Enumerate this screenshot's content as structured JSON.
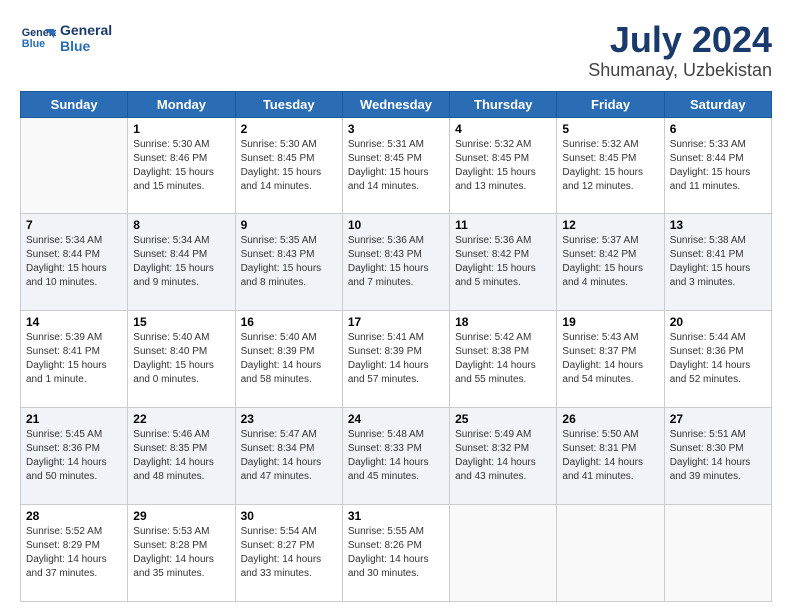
{
  "header": {
    "logo_line1": "General",
    "logo_line2": "Blue",
    "title": "July 2024",
    "subtitle": "Shumanay, Uzbekistan"
  },
  "days_of_week": [
    "Sunday",
    "Monday",
    "Tuesday",
    "Wednesday",
    "Thursday",
    "Friday",
    "Saturday"
  ],
  "weeks": [
    [
      {
        "day": "",
        "info": ""
      },
      {
        "day": "1",
        "info": "Sunrise: 5:30 AM\nSunset: 8:46 PM\nDaylight: 15 hours\nand 15 minutes."
      },
      {
        "day": "2",
        "info": "Sunrise: 5:30 AM\nSunset: 8:45 PM\nDaylight: 15 hours\nand 14 minutes."
      },
      {
        "day": "3",
        "info": "Sunrise: 5:31 AM\nSunset: 8:45 PM\nDaylight: 15 hours\nand 14 minutes."
      },
      {
        "day": "4",
        "info": "Sunrise: 5:32 AM\nSunset: 8:45 PM\nDaylight: 15 hours\nand 13 minutes."
      },
      {
        "day": "5",
        "info": "Sunrise: 5:32 AM\nSunset: 8:45 PM\nDaylight: 15 hours\nand 12 minutes."
      },
      {
        "day": "6",
        "info": "Sunrise: 5:33 AM\nSunset: 8:44 PM\nDaylight: 15 hours\nand 11 minutes."
      }
    ],
    [
      {
        "day": "7",
        "info": "Sunrise: 5:34 AM\nSunset: 8:44 PM\nDaylight: 15 hours\nand 10 minutes."
      },
      {
        "day": "8",
        "info": "Sunrise: 5:34 AM\nSunset: 8:44 PM\nDaylight: 15 hours\nand 9 minutes."
      },
      {
        "day": "9",
        "info": "Sunrise: 5:35 AM\nSunset: 8:43 PM\nDaylight: 15 hours\nand 8 minutes."
      },
      {
        "day": "10",
        "info": "Sunrise: 5:36 AM\nSunset: 8:43 PM\nDaylight: 15 hours\nand 7 minutes."
      },
      {
        "day": "11",
        "info": "Sunrise: 5:36 AM\nSunset: 8:42 PM\nDaylight: 15 hours\nand 5 minutes."
      },
      {
        "day": "12",
        "info": "Sunrise: 5:37 AM\nSunset: 8:42 PM\nDaylight: 15 hours\nand 4 minutes."
      },
      {
        "day": "13",
        "info": "Sunrise: 5:38 AM\nSunset: 8:41 PM\nDaylight: 15 hours\nand 3 minutes."
      }
    ],
    [
      {
        "day": "14",
        "info": "Sunrise: 5:39 AM\nSunset: 8:41 PM\nDaylight: 15 hours\nand 1 minute."
      },
      {
        "day": "15",
        "info": "Sunrise: 5:40 AM\nSunset: 8:40 PM\nDaylight: 15 hours\nand 0 minutes."
      },
      {
        "day": "16",
        "info": "Sunrise: 5:40 AM\nSunset: 8:39 PM\nDaylight: 14 hours\nand 58 minutes."
      },
      {
        "day": "17",
        "info": "Sunrise: 5:41 AM\nSunset: 8:39 PM\nDaylight: 14 hours\nand 57 minutes."
      },
      {
        "day": "18",
        "info": "Sunrise: 5:42 AM\nSunset: 8:38 PM\nDaylight: 14 hours\nand 55 minutes."
      },
      {
        "day": "19",
        "info": "Sunrise: 5:43 AM\nSunset: 8:37 PM\nDaylight: 14 hours\nand 54 minutes."
      },
      {
        "day": "20",
        "info": "Sunrise: 5:44 AM\nSunset: 8:36 PM\nDaylight: 14 hours\nand 52 minutes."
      }
    ],
    [
      {
        "day": "21",
        "info": "Sunrise: 5:45 AM\nSunset: 8:36 PM\nDaylight: 14 hours\nand 50 minutes."
      },
      {
        "day": "22",
        "info": "Sunrise: 5:46 AM\nSunset: 8:35 PM\nDaylight: 14 hours\nand 48 minutes."
      },
      {
        "day": "23",
        "info": "Sunrise: 5:47 AM\nSunset: 8:34 PM\nDaylight: 14 hours\nand 47 minutes."
      },
      {
        "day": "24",
        "info": "Sunrise: 5:48 AM\nSunset: 8:33 PM\nDaylight: 14 hours\nand 45 minutes."
      },
      {
        "day": "25",
        "info": "Sunrise: 5:49 AM\nSunset: 8:32 PM\nDaylight: 14 hours\nand 43 minutes."
      },
      {
        "day": "26",
        "info": "Sunrise: 5:50 AM\nSunset: 8:31 PM\nDaylight: 14 hours\nand 41 minutes."
      },
      {
        "day": "27",
        "info": "Sunrise: 5:51 AM\nSunset: 8:30 PM\nDaylight: 14 hours\nand 39 minutes."
      }
    ],
    [
      {
        "day": "28",
        "info": "Sunrise: 5:52 AM\nSunset: 8:29 PM\nDaylight: 14 hours\nand 37 minutes."
      },
      {
        "day": "29",
        "info": "Sunrise: 5:53 AM\nSunset: 8:28 PM\nDaylight: 14 hours\nand 35 minutes."
      },
      {
        "day": "30",
        "info": "Sunrise: 5:54 AM\nSunset: 8:27 PM\nDaylight: 14 hours\nand 33 minutes."
      },
      {
        "day": "31",
        "info": "Sunrise: 5:55 AM\nSunset: 8:26 PM\nDaylight: 14 hours\nand 30 minutes."
      },
      {
        "day": "",
        "info": ""
      },
      {
        "day": "",
        "info": ""
      },
      {
        "day": "",
        "info": ""
      }
    ]
  ]
}
